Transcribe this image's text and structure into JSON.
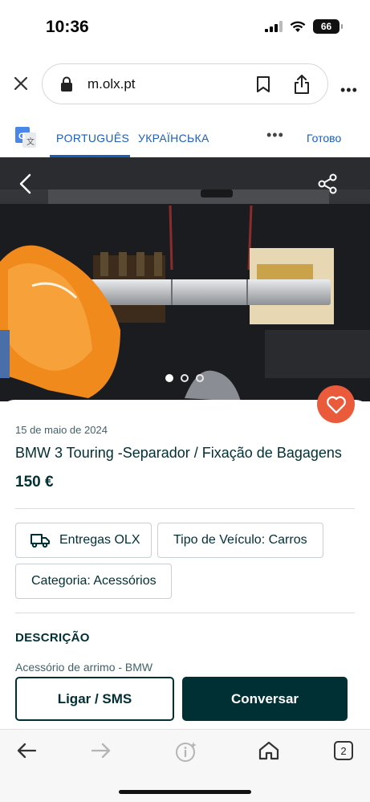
{
  "status_bar": {
    "time": "10:36",
    "battery": "66"
  },
  "browser": {
    "url": "m.olx.pt",
    "more_label": "•••"
  },
  "translate_bar": {
    "source_lang": "PORTUGUÊS",
    "target_lang": "УКРАЇНСЬКА",
    "more_label": "•••",
    "done_label": "Готово"
  },
  "listing": {
    "date": "15 de maio de 2024",
    "title": "BMW 3 Touring -Separador / Fixação de Bagagens",
    "price": "150 €",
    "image_count": 3,
    "active_image": 1,
    "attributes": {
      "delivery": "Entregas OLX",
      "vehicle_type": "Tipo de Veículo: Carros",
      "category": "Categoria: Acessórios"
    },
    "description_heading": "DESCRIÇÃO",
    "description_preview": "Acessório de arrimo - BMW"
  },
  "actions": {
    "call_label": "Ligar / SMS",
    "chat_label": "Conversar"
  },
  "bottom_nav": {
    "tabs_count": "2"
  },
  "colors": {
    "brand_dark": "#002f34",
    "favorite": "#ea5b3c",
    "translate_blue": "#1a5fc0"
  },
  "icons": {
    "status": [
      "signal-icon",
      "wifi-icon",
      "battery-icon"
    ],
    "browser": [
      "close-icon",
      "lock-icon",
      "bookmark-icon",
      "share-icon",
      "more-icon"
    ],
    "hero": [
      "back-arrow-icon",
      "share-nodes-icon"
    ],
    "listing": [
      "heart-icon",
      "truck-icon"
    ],
    "bottom_nav": [
      "back-icon",
      "forward-icon",
      "info-icon",
      "home-icon",
      "tabs-icon"
    ]
  }
}
